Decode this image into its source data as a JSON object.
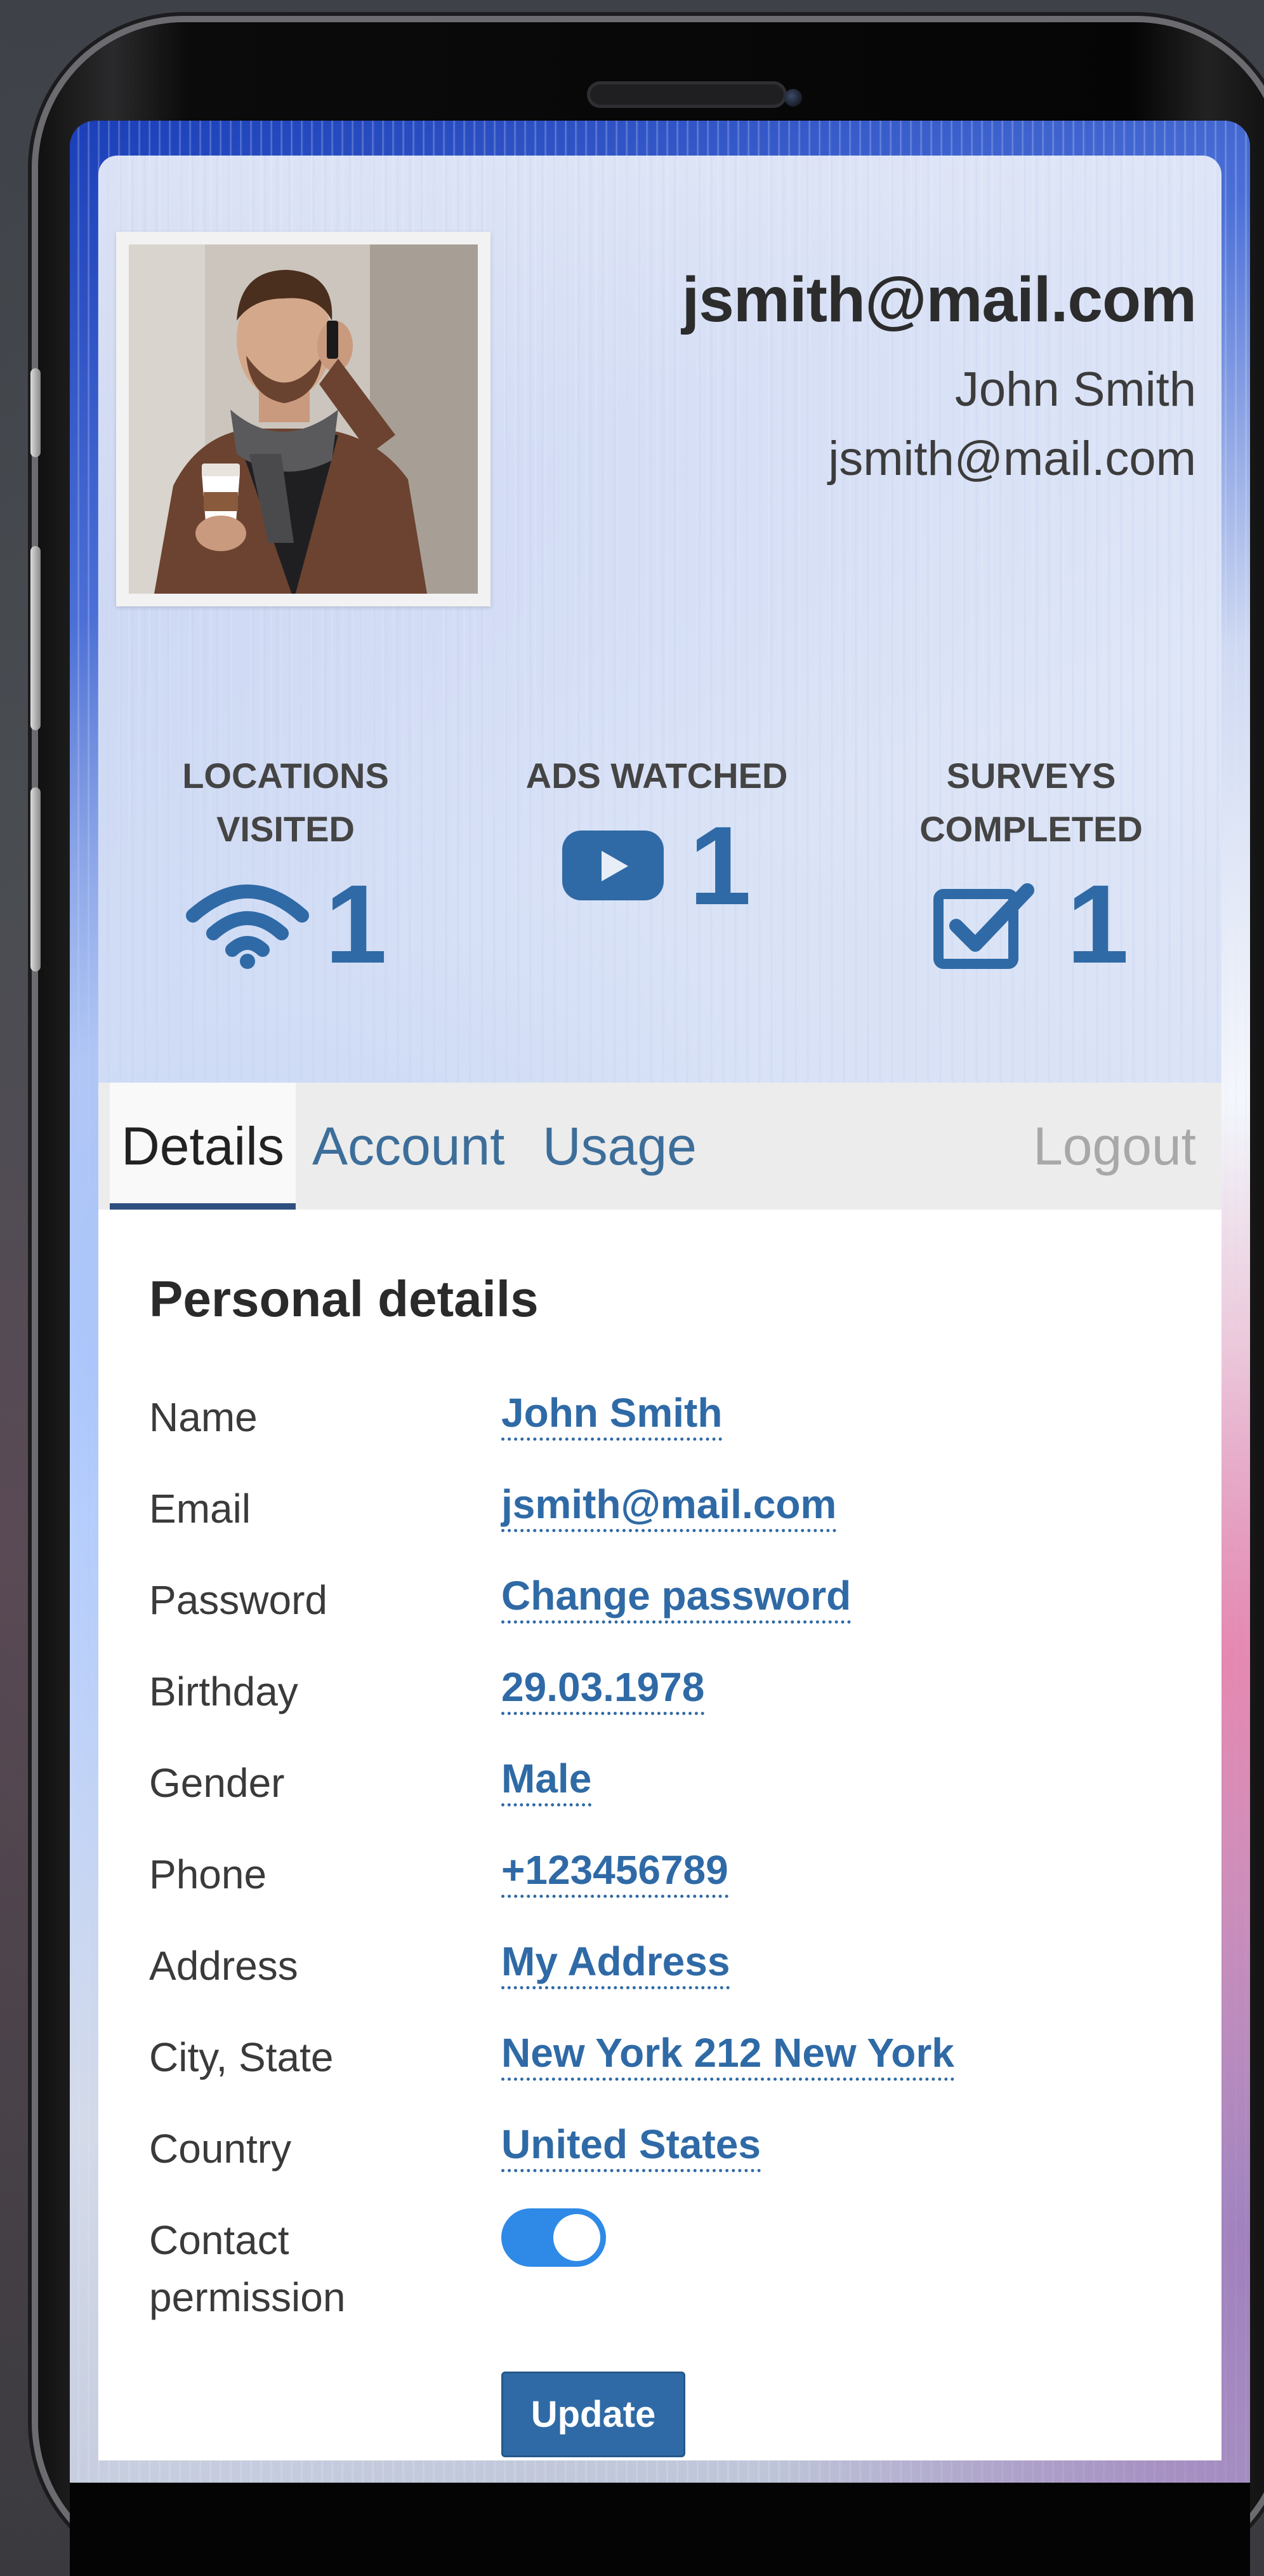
{
  "profile": {
    "title": "jsmith@mail.com",
    "name": "John Smith",
    "email": "jsmith@mail.com"
  },
  "stats": [
    {
      "label_line1": "LOCATIONS",
      "label_line2": "VISITED",
      "value": "1",
      "icon": "wifi-icon"
    },
    {
      "label_line1": "ADS WATCHED",
      "label_line2": "",
      "value": "1",
      "icon": "play-icon"
    },
    {
      "label_line1": "SURVEYS",
      "label_line2": "COMPLETED",
      "value": "1",
      "icon": "checkbox-icon"
    }
  ],
  "tabs": {
    "details": "Details",
    "account": "Account",
    "usage": "Usage",
    "logout": "Logout"
  },
  "panel": {
    "section_title": "Personal details",
    "fields": [
      {
        "label": "Name",
        "value": "John Smith"
      },
      {
        "label": "Email",
        "value": "jsmith@mail.com"
      },
      {
        "label": "Password",
        "value": "Change password"
      },
      {
        "label": "Birthday",
        "value": "29.03.1978"
      },
      {
        "label": "Gender",
        "value": "Male"
      },
      {
        "label": "Phone",
        "value": "+123456789"
      },
      {
        "label": "Address",
        "value": "My Address"
      },
      {
        "label": "City, State",
        "value": "New York 212 New York"
      },
      {
        "label": "Country",
        "value": "United States"
      }
    ],
    "contact_permission": {
      "label_line1": "Contact",
      "label_line2": "permission",
      "enabled": true
    },
    "update_label": "Update"
  },
  "colors": {
    "accent": "#2f6aa6",
    "toggle_on": "#2e8ae6",
    "tab_bar": "#ececec"
  }
}
